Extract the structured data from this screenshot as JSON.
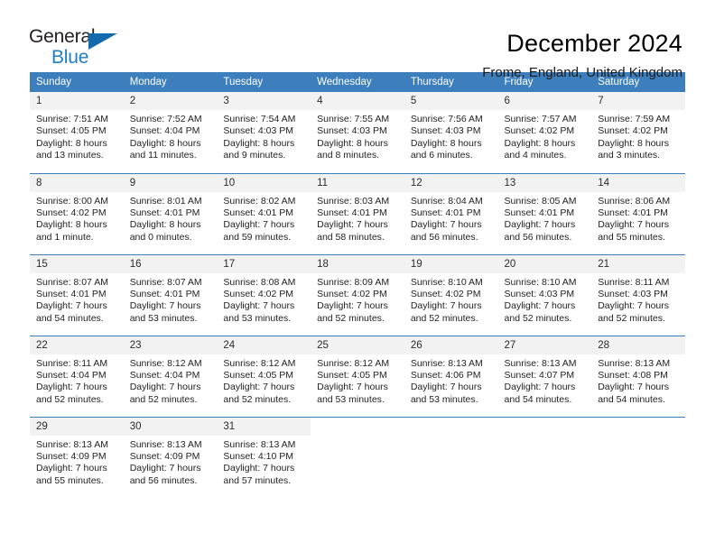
{
  "logo": {
    "word_one": "General",
    "word_two": "Blue",
    "triangle_icon": "triangle-icon",
    "accent_color": "#1569ad",
    "text_color": "#231f20"
  },
  "header": {
    "month_title": "December 2024",
    "location": "Frome, England, United Kingdom"
  },
  "calendar": {
    "header_bg": "#3d7ebd",
    "daynum_bg": "#f2f2f2",
    "weekday_headers": [
      "Sunday",
      "Monday",
      "Tuesday",
      "Wednesday",
      "Thursday",
      "Friday",
      "Saturday"
    ],
    "weeks": [
      [
        {
          "day": "1",
          "sunrise": "Sunrise: 7:51 AM",
          "sunset": "Sunset: 4:05 PM",
          "daylight_line1": "Daylight: 8 hours",
          "daylight_line2": "and 13 minutes."
        },
        {
          "day": "2",
          "sunrise": "Sunrise: 7:52 AM",
          "sunset": "Sunset: 4:04 PM",
          "daylight_line1": "Daylight: 8 hours",
          "daylight_line2": "and 11 minutes."
        },
        {
          "day": "3",
          "sunrise": "Sunrise: 7:54 AM",
          "sunset": "Sunset: 4:03 PM",
          "daylight_line1": "Daylight: 8 hours",
          "daylight_line2": "and 9 minutes."
        },
        {
          "day": "4",
          "sunrise": "Sunrise: 7:55 AM",
          "sunset": "Sunset: 4:03 PM",
          "daylight_line1": "Daylight: 8 hours",
          "daylight_line2": "and 8 minutes."
        },
        {
          "day": "5",
          "sunrise": "Sunrise: 7:56 AM",
          "sunset": "Sunset: 4:03 PM",
          "daylight_line1": "Daylight: 8 hours",
          "daylight_line2": "and 6 minutes."
        },
        {
          "day": "6",
          "sunrise": "Sunrise: 7:57 AM",
          "sunset": "Sunset: 4:02 PM",
          "daylight_line1": "Daylight: 8 hours",
          "daylight_line2": "and 4 minutes."
        },
        {
          "day": "7",
          "sunrise": "Sunrise: 7:59 AM",
          "sunset": "Sunset: 4:02 PM",
          "daylight_line1": "Daylight: 8 hours",
          "daylight_line2": "and 3 minutes."
        }
      ],
      [
        {
          "day": "8",
          "sunrise": "Sunrise: 8:00 AM",
          "sunset": "Sunset: 4:02 PM",
          "daylight_line1": "Daylight: 8 hours",
          "daylight_line2": "and 1 minute."
        },
        {
          "day": "9",
          "sunrise": "Sunrise: 8:01 AM",
          "sunset": "Sunset: 4:01 PM",
          "daylight_line1": "Daylight: 8 hours",
          "daylight_line2": "and 0 minutes."
        },
        {
          "day": "10",
          "sunrise": "Sunrise: 8:02 AM",
          "sunset": "Sunset: 4:01 PM",
          "daylight_line1": "Daylight: 7 hours",
          "daylight_line2": "and 59 minutes."
        },
        {
          "day": "11",
          "sunrise": "Sunrise: 8:03 AM",
          "sunset": "Sunset: 4:01 PM",
          "daylight_line1": "Daylight: 7 hours",
          "daylight_line2": "and 58 minutes."
        },
        {
          "day": "12",
          "sunrise": "Sunrise: 8:04 AM",
          "sunset": "Sunset: 4:01 PM",
          "daylight_line1": "Daylight: 7 hours",
          "daylight_line2": "and 56 minutes."
        },
        {
          "day": "13",
          "sunrise": "Sunrise: 8:05 AM",
          "sunset": "Sunset: 4:01 PM",
          "daylight_line1": "Daylight: 7 hours",
          "daylight_line2": "and 56 minutes."
        },
        {
          "day": "14",
          "sunrise": "Sunrise: 8:06 AM",
          "sunset": "Sunset: 4:01 PM",
          "daylight_line1": "Daylight: 7 hours",
          "daylight_line2": "and 55 minutes."
        }
      ],
      [
        {
          "day": "15",
          "sunrise": "Sunrise: 8:07 AM",
          "sunset": "Sunset: 4:01 PM",
          "daylight_line1": "Daylight: 7 hours",
          "daylight_line2": "and 54 minutes."
        },
        {
          "day": "16",
          "sunrise": "Sunrise: 8:07 AM",
          "sunset": "Sunset: 4:01 PM",
          "daylight_line1": "Daylight: 7 hours",
          "daylight_line2": "and 53 minutes."
        },
        {
          "day": "17",
          "sunrise": "Sunrise: 8:08 AM",
          "sunset": "Sunset: 4:02 PM",
          "daylight_line1": "Daylight: 7 hours",
          "daylight_line2": "and 53 minutes."
        },
        {
          "day": "18",
          "sunrise": "Sunrise: 8:09 AM",
          "sunset": "Sunset: 4:02 PM",
          "daylight_line1": "Daylight: 7 hours",
          "daylight_line2": "and 52 minutes."
        },
        {
          "day": "19",
          "sunrise": "Sunrise: 8:10 AM",
          "sunset": "Sunset: 4:02 PM",
          "daylight_line1": "Daylight: 7 hours",
          "daylight_line2": "and 52 minutes."
        },
        {
          "day": "20",
          "sunrise": "Sunrise: 8:10 AM",
          "sunset": "Sunset: 4:03 PM",
          "daylight_line1": "Daylight: 7 hours",
          "daylight_line2": "and 52 minutes."
        },
        {
          "day": "21",
          "sunrise": "Sunrise: 8:11 AM",
          "sunset": "Sunset: 4:03 PM",
          "daylight_line1": "Daylight: 7 hours",
          "daylight_line2": "and 52 minutes."
        }
      ],
      [
        {
          "day": "22",
          "sunrise": "Sunrise: 8:11 AM",
          "sunset": "Sunset: 4:04 PM",
          "daylight_line1": "Daylight: 7 hours",
          "daylight_line2": "and 52 minutes."
        },
        {
          "day": "23",
          "sunrise": "Sunrise: 8:12 AM",
          "sunset": "Sunset: 4:04 PM",
          "daylight_line1": "Daylight: 7 hours",
          "daylight_line2": "and 52 minutes."
        },
        {
          "day": "24",
          "sunrise": "Sunrise: 8:12 AM",
          "sunset": "Sunset: 4:05 PM",
          "daylight_line1": "Daylight: 7 hours",
          "daylight_line2": "and 52 minutes."
        },
        {
          "day": "25",
          "sunrise": "Sunrise: 8:12 AM",
          "sunset": "Sunset: 4:05 PM",
          "daylight_line1": "Daylight: 7 hours",
          "daylight_line2": "and 53 minutes."
        },
        {
          "day": "26",
          "sunrise": "Sunrise: 8:13 AM",
          "sunset": "Sunset: 4:06 PM",
          "daylight_line1": "Daylight: 7 hours",
          "daylight_line2": "and 53 minutes."
        },
        {
          "day": "27",
          "sunrise": "Sunrise: 8:13 AM",
          "sunset": "Sunset: 4:07 PM",
          "daylight_line1": "Daylight: 7 hours",
          "daylight_line2": "and 54 minutes."
        },
        {
          "day": "28",
          "sunrise": "Sunrise: 8:13 AM",
          "sunset": "Sunset: 4:08 PM",
          "daylight_line1": "Daylight: 7 hours",
          "daylight_line2": "and 54 minutes."
        }
      ],
      [
        {
          "day": "29",
          "sunrise": "Sunrise: 8:13 AM",
          "sunset": "Sunset: 4:09 PM",
          "daylight_line1": "Daylight: 7 hours",
          "daylight_line2": "and 55 minutes."
        },
        {
          "day": "30",
          "sunrise": "Sunrise: 8:13 AM",
          "sunset": "Sunset: 4:09 PM",
          "daylight_line1": "Daylight: 7 hours",
          "daylight_line2": "and 56 minutes."
        },
        {
          "day": "31",
          "sunrise": "Sunrise: 8:13 AM",
          "sunset": "Sunset: 4:10 PM",
          "daylight_line1": "Daylight: 7 hours",
          "daylight_line2": "and 57 minutes."
        },
        null,
        null,
        null,
        null
      ]
    ]
  }
}
